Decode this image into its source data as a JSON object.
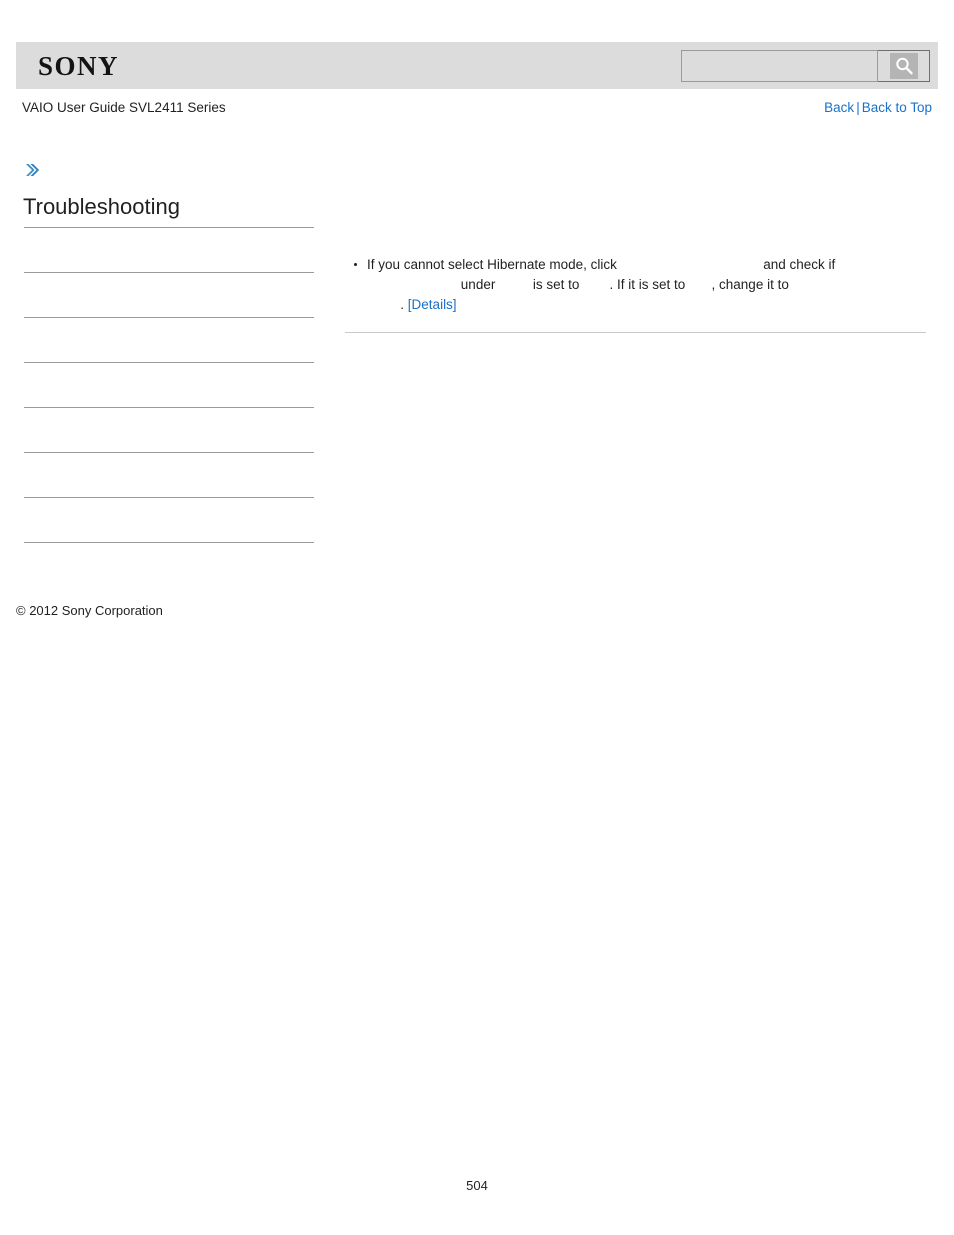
{
  "header": {
    "logo_text": "SONY",
    "search": {
      "value": "",
      "placeholder": "",
      "icon": "search-icon"
    }
  },
  "title_row": {
    "guide_title": "VAIO User Guide SVL2411 Series",
    "back_label": "Back",
    "separator": "|",
    "back_to_top_label": "Back to Top"
  },
  "sidebar": {
    "breadcrumb_icon": "double-chevron-right-icon",
    "heading": "Troubleshooting",
    "items": [
      {
        "label": ""
      },
      {
        "label": ""
      },
      {
        "label": ""
      },
      {
        "label": ""
      },
      {
        "label": ""
      },
      {
        "label": ""
      },
      {
        "label": ""
      }
    ]
  },
  "content": {
    "bullet": {
      "line1_before": "If you cannot select Hibernate mode, click",
      "line1_term": "                                     ",
      "line1_after": "and",
      "line2_a": "check if",
      "line2_term1": "                        ",
      "line2_b": "under",
      "line2_term2": "        ",
      "line2_c": "is set to",
      "line2_term3": "      ",
      "line2_d": ". If it is set to",
      "line2_term4": "     ",
      "line2_e": ", change it to",
      "line3_term": "   ",
      "line3_period": ".",
      "line3_details": "[Details]"
    }
  },
  "footer": {
    "copyright": "© 2012 Sony Corporation",
    "page_number": "504"
  },
  "colors": {
    "header_bg": "#dcdcdc",
    "link_blue": "#1a72c8",
    "chevron_blue": "#3d8fc9",
    "rule_gray": "#9b9b9b",
    "content_rule": "#c9c9c9",
    "text": "#231f20"
  }
}
